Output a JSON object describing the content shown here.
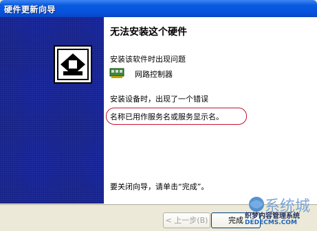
{
  "window": {
    "title": "硬件更新向导"
  },
  "content": {
    "heading": "无法安装这个硬件",
    "line1": "安装该软件时出现问题",
    "device": {
      "icon": "network-card-icon",
      "label": "网路控制器"
    },
    "line3": "安装设备时，出现了一个错误",
    "error": "名称已用作服务名或服务显示名。",
    "finish_hint": "要关闭向导，请单击“完成”。"
  },
  "buttons": {
    "back": "< 上一步(B)",
    "next": "完成"
  },
  "watermark": {
    "brand": "系统城",
    "line1": "织梦内容管理系统",
    "line2": "DEDECMS.COM"
  },
  "colors": {
    "title_bar": "#0a5ae0",
    "left_pane": "#1c2a9e",
    "error_border": "#c8102e"
  }
}
